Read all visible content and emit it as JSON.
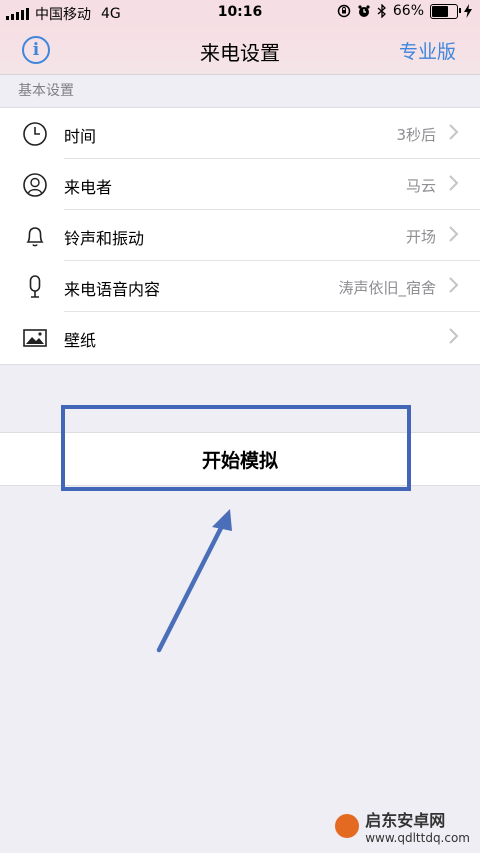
{
  "status_bar": {
    "carrier": "中国移动",
    "network": "4G",
    "time": "10:16",
    "battery": "66%",
    "battery_level": 0.66
  },
  "nav": {
    "title": "来电设置",
    "pro_label": "专业版",
    "info_glyph": "i"
  },
  "section": {
    "header": "基本设置",
    "items": [
      {
        "icon": "clock-icon",
        "label": "时间",
        "value": "3秒后"
      },
      {
        "icon": "person-icon",
        "label": "来电者",
        "value": "马云"
      },
      {
        "icon": "bell-icon",
        "label": "铃声和振动",
        "value": "开场"
      },
      {
        "icon": "microphone-icon",
        "label": "来电语音内容",
        "value": "涛声依旧_宿舍"
      },
      {
        "icon": "picture-icon",
        "label": "壁纸",
        "value": ""
      }
    ]
  },
  "start_button": {
    "label": "开始模拟"
  },
  "watermark": {
    "main": "启东安卓网",
    "sub": "www.qdlttdq.com"
  },
  "colors": {
    "accent": "#3f86dc",
    "highlight": "#4166b8",
    "nav_bg": "#f6dfe4",
    "page_bg": "#efeef4"
  }
}
